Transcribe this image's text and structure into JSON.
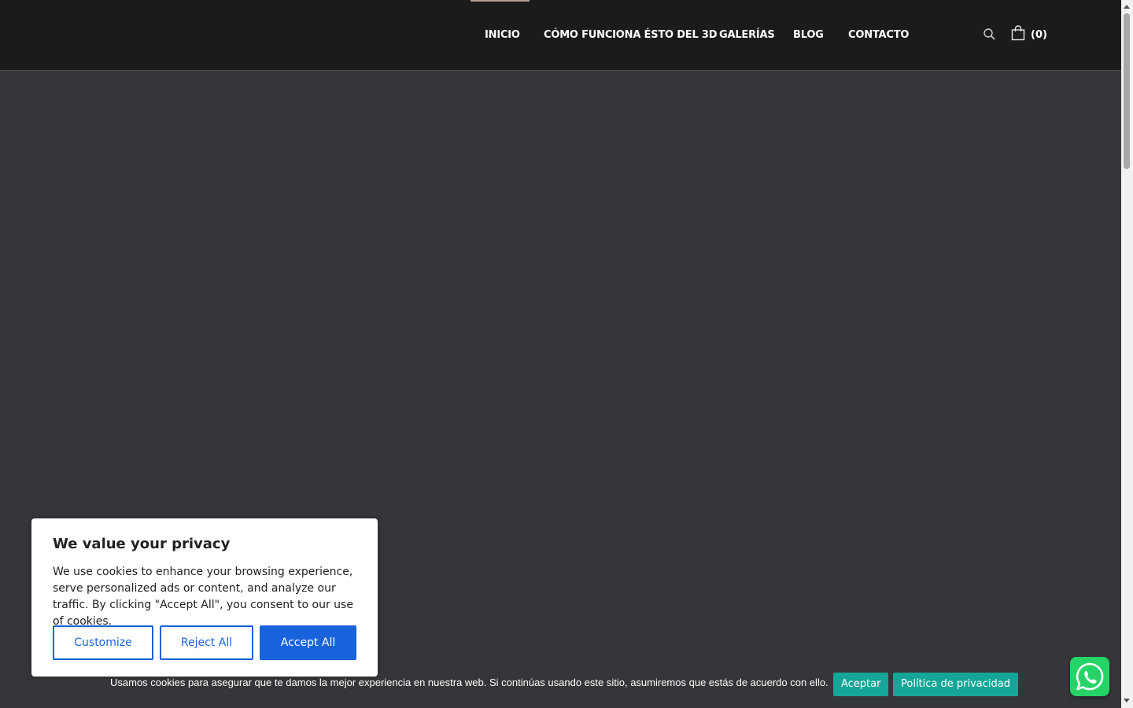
{
  "header": {
    "nav": [
      {
        "label": "INICIO"
      },
      {
        "label": "CÓMO FUNCIONA ÉSTO DEL 3D"
      },
      {
        "label": "GALERÍAS"
      },
      {
        "label": "BLOG"
      },
      {
        "label": "CONTACTO"
      }
    ],
    "search_icon": "search-icon",
    "cart_icon": "shopping-bag-icon",
    "cart_count": "(0)"
  },
  "cookie_notice": {
    "text": "Usamos cookies para asegurar que te damos la mejor experiencia en nuestra web. Si continúas usando este sitio, asumiremos que estás de acuerdo con ello.",
    "accept_label": "Aceptar",
    "policy_label": "Política de privacidad"
  },
  "privacy_dialog": {
    "title": "We value your privacy",
    "body": "We use cookies to enhance your browsing experience, serve personalized ads or content, and analyze our traffic. By clicking \"Accept All\", you consent to our use of cookies.",
    "customize_label": "Customize",
    "reject_label": "Reject All",
    "accept_label": "Accept All"
  },
  "widgets": {
    "whatsapp_icon": "whatsapp-icon"
  },
  "colors": {
    "header_bg": "#1b1b1b",
    "page_bg": "#35363a",
    "accent_teal": "#16a697",
    "accent_blue": "#1863dc",
    "whatsapp_green": "#25d366"
  }
}
